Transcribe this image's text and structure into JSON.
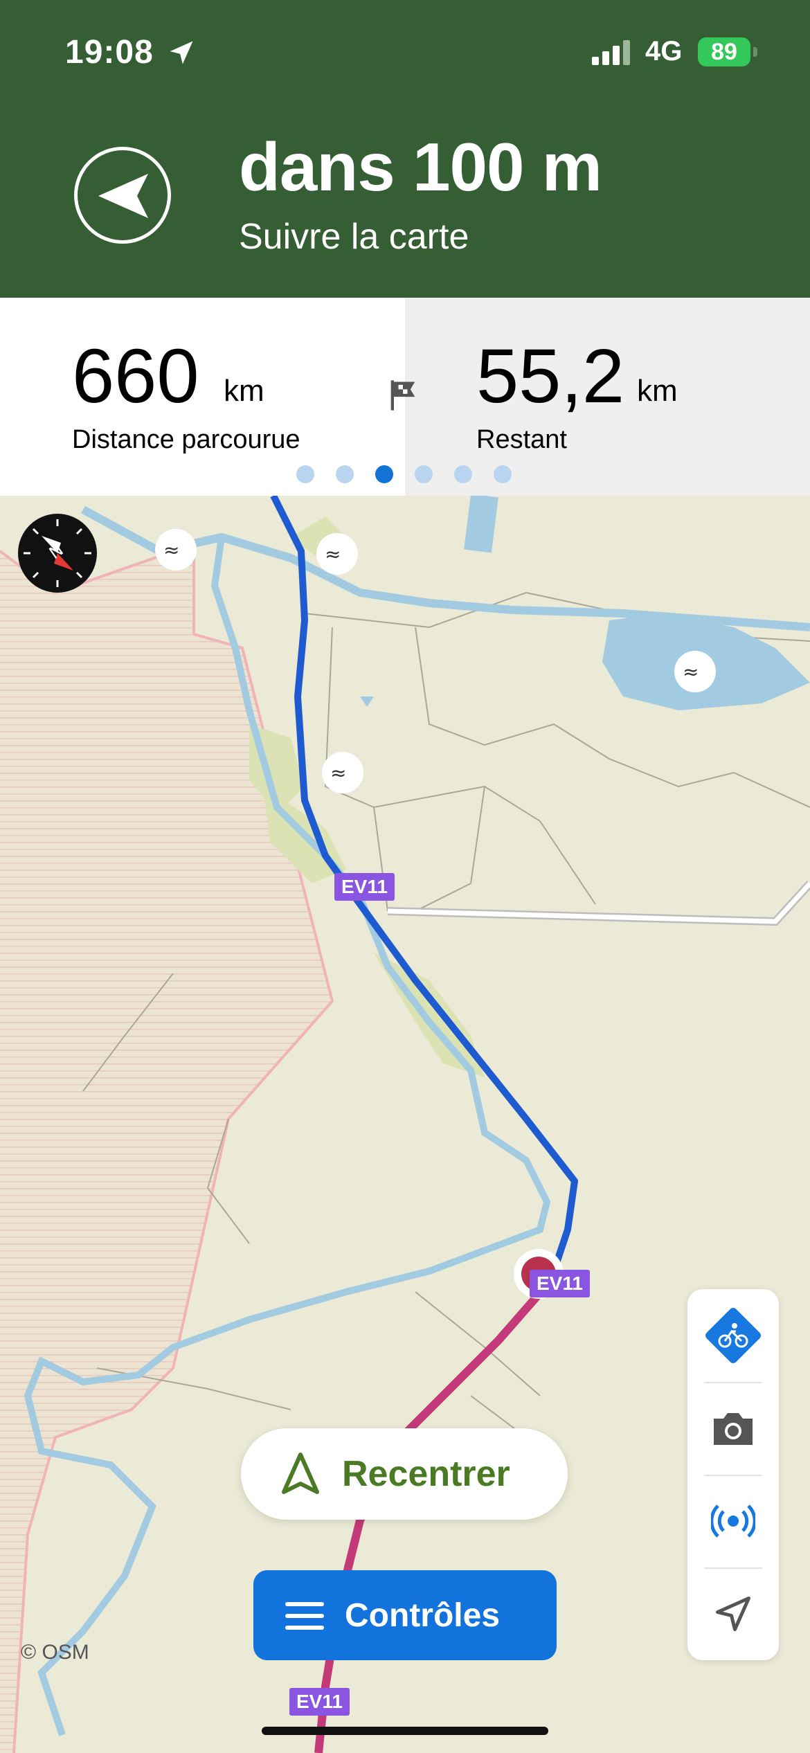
{
  "status_bar": {
    "time": "19:08",
    "network": "4G",
    "battery": "89"
  },
  "instruction": {
    "distance": "dans 100 m",
    "text": "Suivre la carte",
    "icon": "turn-left-arrow-icon"
  },
  "stats": {
    "traveled": {
      "value": "660",
      "unit": "km",
      "label": "Distance parcourue"
    },
    "remaining": {
      "value": "55,2",
      "unit": "km",
      "label": "Restant"
    },
    "flag_icon": "checkered-flag-icon",
    "page_dots": {
      "count": 6,
      "active_index": 2
    }
  },
  "map": {
    "route_badge": "EV11",
    "attribution": "© OSM",
    "colors": {
      "route_planned": "#1e5bd0",
      "route_traveled": "#c43a78",
      "water": "#a2cbe1",
      "land": "#eaead6",
      "border": "#f0b4b8"
    }
  },
  "side_controls": [
    {
      "name": "bike-mode-button",
      "icon": "bicycle-icon"
    },
    {
      "name": "camera-button",
      "icon": "camera-icon"
    },
    {
      "name": "broadcast-button",
      "icon": "radio-signal-icon"
    },
    {
      "name": "location-button",
      "icon": "location-arrow-icon"
    }
  ],
  "buttons": {
    "recenter": "Recentrer",
    "controls": "Contrôles"
  }
}
